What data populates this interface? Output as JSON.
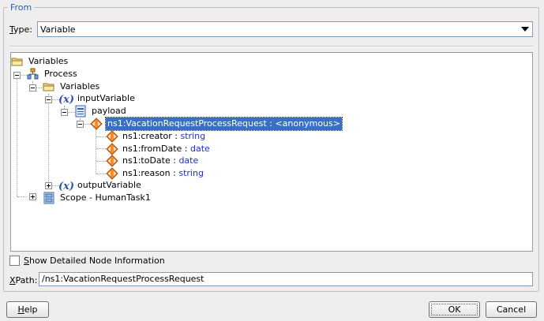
{
  "group": {
    "legend": "From"
  },
  "type_field": {
    "label_mnemonic": "T",
    "label_rest": "ype:",
    "selected": "Variable"
  },
  "tree": {
    "root": "Variables",
    "process": "Process",
    "variables": "Variables",
    "input_variable": "inputVariable",
    "payload": "payload",
    "request_element": "ns1:VacationRequestProcessRequest : <anonymous>",
    "fields": [
      {
        "name": "ns1:creator",
        "sep": " : ",
        "type": "string"
      },
      {
        "name": "ns1:fromDate",
        "sep": " : ",
        "type": "date"
      },
      {
        "name": "ns1:toDate",
        "sep": " : ",
        "type": "date"
      },
      {
        "name": "ns1:reason",
        "sep": " : ",
        "type": "string"
      }
    ],
    "output_variable": "outputVariable",
    "scope": "Scope - HumanTask1"
  },
  "checkbox": {
    "label_mnemonic": "S",
    "label_rest": "how Detailed Node Information",
    "checked": false
  },
  "xpath": {
    "label_mnemonic": "X",
    "label_rest": "Path:",
    "value": "/ns1:VacationRequestProcessRequest"
  },
  "buttons": {
    "help_mnemonic": "H",
    "help_rest": "elp",
    "ok": "OK",
    "cancel": "Cancel"
  },
  "colors": {
    "selection": "#3b6fc6",
    "type_text": "#1a32c8",
    "legend_text": "#2a5bb0"
  }
}
